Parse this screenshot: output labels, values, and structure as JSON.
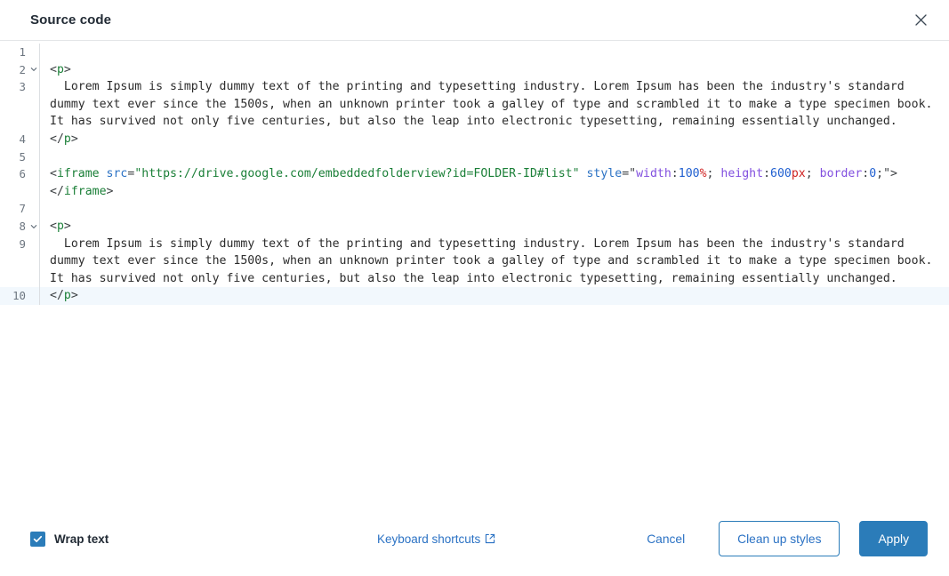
{
  "header": {
    "title": "Source code",
    "close_icon": "close-icon"
  },
  "editor": {
    "active_line": 10,
    "lines": [
      {
        "number": "1",
        "fold": false,
        "segments": []
      },
      {
        "number": "2",
        "fold": true,
        "segments": [
          {
            "text": "<",
            "cls": "t-punct"
          },
          {
            "text": "p",
            "cls": "t-tag"
          },
          {
            "text": ">",
            "cls": "t-punct"
          }
        ]
      },
      {
        "number": "3",
        "fold": false,
        "segments": [
          {
            "text": "  Lorem Ipsum is simply dummy text of the printing and typesetting industry. Lorem Ipsum has been the industry's standard dummy text ever since the 1500s, when an unknown printer took a galley of type and scrambled it to make a type specimen book. It has survived not only five centuries, but also the leap into electronic typesetting, remaining essentially unchanged.",
            "cls": "t-plain"
          }
        ]
      },
      {
        "number": "4",
        "fold": false,
        "segments": [
          {
            "text": "</",
            "cls": "t-punct"
          },
          {
            "text": "p",
            "cls": "t-tag"
          },
          {
            "text": ">",
            "cls": "t-punct"
          }
        ]
      },
      {
        "number": "5",
        "fold": false,
        "segments": []
      },
      {
        "number": "6",
        "fold": false,
        "segments": [
          {
            "text": "<",
            "cls": "t-punct"
          },
          {
            "text": "iframe",
            "cls": "t-tag"
          },
          {
            "text": " ",
            "cls": "t-plain"
          },
          {
            "text": "src",
            "cls": "t-attr"
          },
          {
            "text": "=",
            "cls": "t-punct"
          },
          {
            "text": "\"https://drive.google.com/embeddedfolderview?id=FOLDER-ID#list\"",
            "cls": "t-str"
          },
          {
            "text": " ",
            "cls": "t-plain"
          },
          {
            "text": "style",
            "cls": "t-attr"
          },
          {
            "text": "=",
            "cls": "t-punct"
          },
          {
            "text": "\"",
            "cls": "t-punct"
          },
          {
            "text": "width",
            "cls": "t-prop"
          },
          {
            "text": ":",
            "cls": "t-punct"
          },
          {
            "text": "100",
            "cls": "t-num"
          },
          {
            "text": "%",
            "cls": "t-unit"
          },
          {
            "text": "; ",
            "cls": "t-punct"
          },
          {
            "text": "height",
            "cls": "t-prop"
          },
          {
            "text": ":",
            "cls": "t-punct"
          },
          {
            "text": "600",
            "cls": "t-num"
          },
          {
            "text": "px",
            "cls": "t-unit"
          },
          {
            "text": "; ",
            "cls": "t-punct"
          },
          {
            "text": "border",
            "cls": "t-prop"
          },
          {
            "text": ":",
            "cls": "t-punct"
          },
          {
            "text": "0",
            "cls": "t-num"
          },
          {
            "text": ";\">",
            "cls": "t-punct"
          }
        ]
      },
      {
        "number": "",
        "fold": false,
        "continuation": true,
        "segments": [
          {
            "text": "</",
            "cls": "t-punct"
          },
          {
            "text": "iframe",
            "cls": "t-tag"
          },
          {
            "text": ">",
            "cls": "t-punct"
          }
        ]
      },
      {
        "number": "7",
        "fold": false,
        "segments": []
      },
      {
        "number": "8",
        "fold": true,
        "segments": [
          {
            "text": "<",
            "cls": "t-punct"
          },
          {
            "text": "p",
            "cls": "t-tag"
          },
          {
            "text": ">",
            "cls": "t-punct"
          }
        ]
      },
      {
        "number": "9",
        "fold": false,
        "segments": [
          {
            "text": "  Lorem Ipsum is simply dummy text of the printing and typesetting industry. Lorem Ipsum has been the industry's standard dummy text ever since the 1500s, when an unknown printer took a galley of type and scrambled it to make a type specimen book. It has survived not only five centuries, but also the leap into electronic typesetting, remaining essentially unchanged.",
            "cls": "t-plain"
          }
        ]
      },
      {
        "number": "10",
        "fold": false,
        "active": true,
        "segments": [
          {
            "text": "</",
            "cls": "t-punct"
          },
          {
            "text": "p",
            "cls": "t-tag"
          },
          {
            "text": ">",
            "cls": "t-punct"
          }
        ]
      }
    ]
  },
  "footer": {
    "wrap_text_label": "Wrap text",
    "wrap_text_checked": true,
    "keyboard_shortcuts_label": "Keyboard shortcuts",
    "external_link_icon": "external-link-icon",
    "cancel_label": "Cancel",
    "clean_up_styles_label": "Clean up styles",
    "apply_label": "Apply"
  },
  "colors": {
    "accent": "#2b7cb9",
    "link": "#2b72c4",
    "tag": "#1a7f37",
    "attr": "#2b72c4",
    "string": "#1a7f37",
    "css_property": "#8250df",
    "number": "#1f5fd0",
    "unit": "#cf2222",
    "active_line": "#f2f8fd"
  }
}
